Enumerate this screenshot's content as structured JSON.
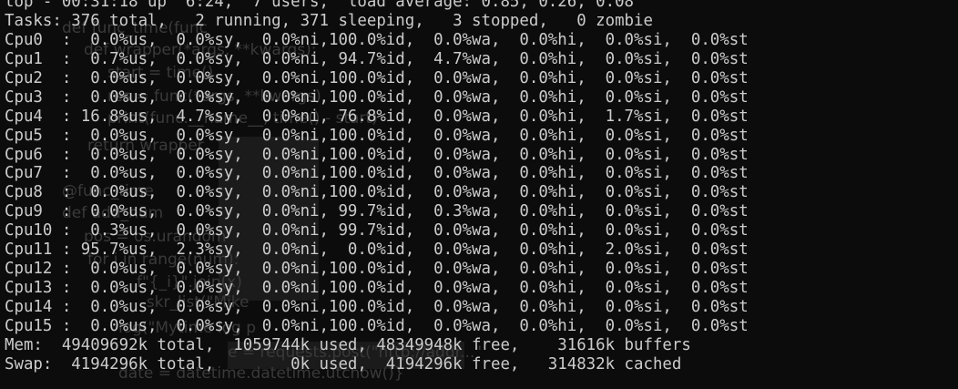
{
  "terminal": {
    "program": "top",
    "lines": [
      "top - 00:31:18 up  6:24,  7 users,  load average: 0.85, 0.26, 0.08",
      "Tasks: 376 total,   2 running, 371 sleeping,   3 stopped,   0 zombie",
      "Cpu0  :  0.0%us,  0.0%sy,  0.0%ni,100.0%id,  0.0%wa,  0.0%hi,  0.0%si,  0.0%st",
      "Cpu1  :  0.7%us,  0.0%sy,  0.0%ni, 94.7%id,  4.7%wa,  0.0%hi,  0.0%si,  0.0%st",
      "Cpu2  :  0.0%us,  0.0%sy,  0.0%ni,100.0%id,  0.0%wa,  0.0%hi,  0.0%si,  0.0%st",
      "Cpu3  :  0.0%us,  0.0%sy,  0.0%ni,100.0%id,  0.0%wa,  0.0%hi,  0.0%si,  0.0%st",
      "Cpu4  : 16.8%us,  4.7%sy,  0.0%ni, 76.8%id,  0.0%wa,  0.0%hi,  1.7%si,  0.0%st",
      "Cpu5  :  0.0%us,  0.0%sy,  0.0%ni,100.0%id,  0.0%wa,  0.0%hi,  0.0%si,  0.0%st",
      "Cpu6  :  0.0%us,  0.0%sy,  0.0%ni,100.0%id,  0.0%wa,  0.0%hi,  0.0%si,  0.0%st",
      "Cpu7  :  0.0%us,  0.0%sy,  0.0%ni,100.0%id,  0.0%wa,  0.0%hi,  0.0%si,  0.0%st",
      "Cpu8  :  0.0%us,  0.0%sy,  0.0%ni,100.0%id,  0.0%wa,  0.0%hi,  0.0%si,  0.0%st",
      "Cpu9  :  0.0%us,  0.0%sy,  0.0%ni, 99.7%id,  0.3%wa,  0.0%hi,  0.0%si,  0.0%st",
      "Cpu10 :  0.3%us,  0.0%sy,  0.0%ni, 99.7%id,  0.0%wa,  0.0%hi,  0.0%si,  0.0%st",
      "Cpu11 : 95.7%us,  2.3%sy,  0.0%ni,  0.0%id,  0.0%wa,  0.0%hi,  2.0%si,  0.0%st",
      "Cpu12 :  0.0%us,  0.0%sy,  0.0%ni,100.0%id,  0.0%wa,  0.0%hi,  0.0%si,  0.0%st",
      "Cpu13 :  0.0%us,  0.0%sy,  0.0%ni,100.0%id,  0.0%wa,  0.0%hi,  0.0%si,  0.0%st",
      "Cpu14 :  0.0%us,  0.0%sy,  0.0%ni,100.0%id,  0.0%wa,  0.0%hi,  0.0%si,  0.0%st",
      "Cpu15 :  0.0%us,  0.0%sy,  0.0%ni,100.0%id,  0.0%wa,  0.0%hi,  0.0%si,  0.0%st",
      "Mem:  49409692k total,  1059744k used, 48349948k free,    31616k buffers",
      "Swap:  4194296k total,        0k used,  4194296k free,   314832k cached"
    ]
  },
  "ghost_text": {
    "line1": "def func_time(func",
    "line2": "def wrapper(*args, **kwargs):",
    "line3": "start = time()",
    "line4": "res = func(*args, **kwargs)",
    "line5": "print(func.__name__, time() - start)",
    "line6": "return wrapper",
    "line7": "@func_time",
    "line8": "def add_num",
    "line9": "pos = os.urandom",
    "line10": "for i in range(num):",
    "line11": "f\"{_i}\".join(x)",
    "line12": "  skr_list(\"Mike",
    "line13": "log(\"Mytime log p",
    "line14": "e = requests.post(\"http://addr...\"",
    "line15": "date = datetime.datetime.utcnow()}"
  },
  "colors": {
    "background": "#0c0c0c",
    "foreground": "#cccccc",
    "ghost": "#3a3a3a"
  }
}
